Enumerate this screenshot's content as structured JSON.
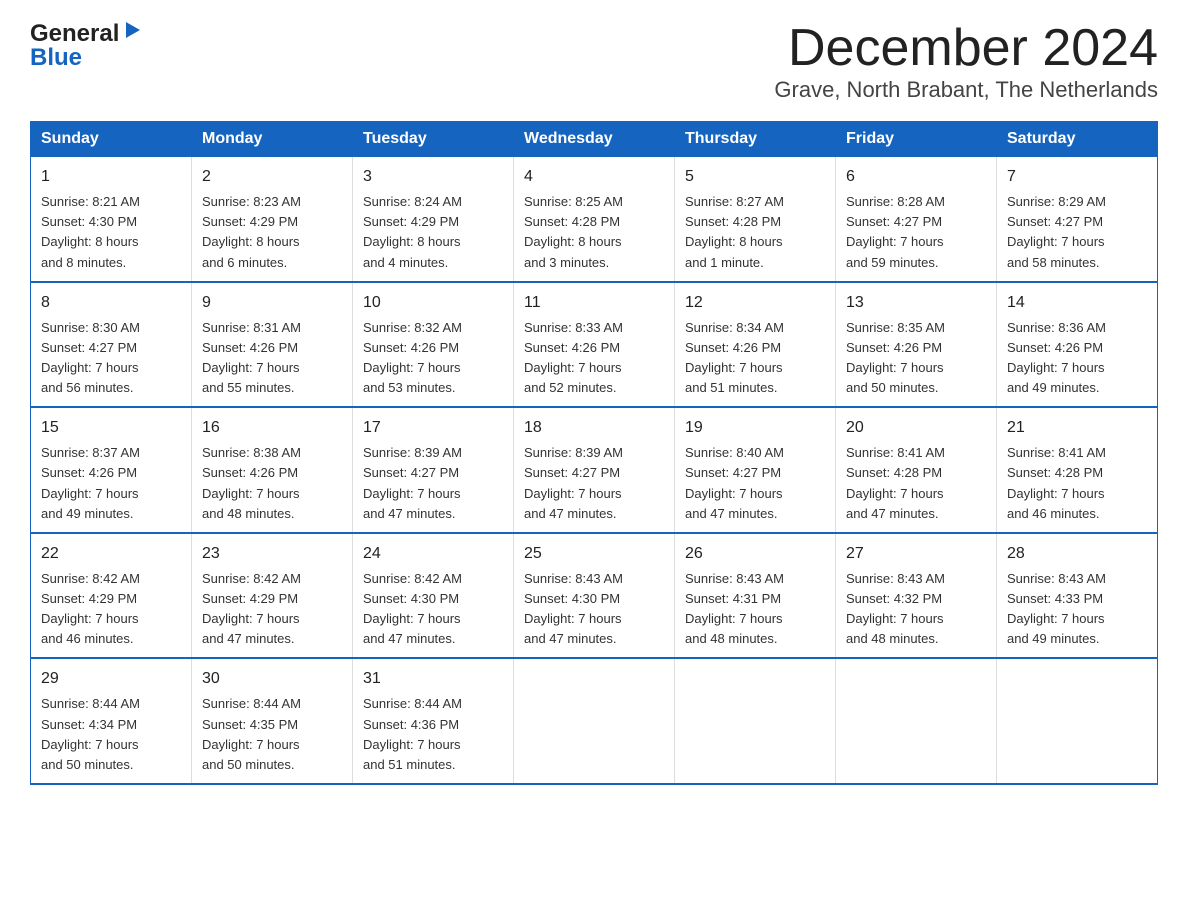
{
  "header": {
    "logo_general": "General",
    "logo_blue": "Blue",
    "month_title": "December 2024",
    "location": "Grave, North Brabant, The Netherlands"
  },
  "days_of_week": [
    "Sunday",
    "Monday",
    "Tuesday",
    "Wednesday",
    "Thursday",
    "Friday",
    "Saturday"
  ],
  "weeks": [
    [
      {
        "num": "1",
        "sunrise": "8:21 AM",
        "sunset": "4:30 PM",
        "daylight": "8 hours and 8 minutes."
      },
      {
        "num": "2",
        "sunrise": "8:23 AM",
        "sunset": "4:29 PM",
        "daylight": "8 hours and 6 minutes."
      },
      {
        "num": "3",
        "sunrise": "8:24 AM",
        "sunset": "4:29 PM",
        "daylight": "8 hours and 4 minutes."
      },
      {
        "num": "4",
        "sunrise": "8:25 AM",
        "sunset": "4:28 PM",
        "daylight": "8 hours and 3 minutes."
      },
      {
        "num": "5",
        "sunrise": "8:27 AM",
        "sunset": "4:28 PM",
        "daylight": "8 hours and 1 minute."
      },
      {
        "num": "6",
        "sunrise": "8:28 AM",
        "sunset": "4:27 PM",
        "daylight": "7 hours and 59 minutes."
      },
      {
        "num": "7",
        "sunrise": "8:29 AM",
        "sunset": "4:27 PM",
        "daylight": "7 hours and 58 minutes."
      }
    ],
    [
      {
        "num": "8",
        "sunrise": "8:30 AM",
        "sunset": "4:27 PM",
        "daylight": "7 hours and 56 minutes."
      },
      {
        "num": "9",
        "sunrise": "8:31 AM",
        "sunset": "4:26 PM",
        "daylight": "7 hours and 55 minutes."
      },
      {
        "num": "10",
        "sunrise": "8:32 AM",
        "sunset": "4:26 PM",
        "daylight": "7 hours and 53 minutes."
      },
      {
        "num": "11",
        "sunrise": "8:33 AM",
        "sunset": "4:26 PM",
        "daylight": "7 hours and 52 minutes."
      },
      {
        "num": "12",
        "sunrise": "8:34 AM",
        "sunset": "4:26 PM",
        "daylight": "7 hours and 51 minutes."
      },
      {
        "num": "13",
        "sunrise": "8:35 AM",
        "sunset": "4:26 PM",
        "daylight": "7 hours and 50 minutes."
      },
      {
        "num": "14",
        "sunrise": "8:36 AM",
        "sunset": "4:26 PM",
        "daylight": "7 hours and 49 minutes."
      }
    ],
    [
      {
        "num": "15",
        "sunrise": "8:37 AM",
        "sunset": "4:26 PM",
        "daylight": "7 hours and 49 minutes."
      },
      {
        "num": "16",
        "sunrise": "8:38 AM",
        "sunset": "4:26 PM",
        "daylight": "7 hours and 48 minutes."
      },
      {
        "num": "17",
        "sunrise": "8:39 AM",
        "sunset": "4:27 PM",
        "daylight": "7 hours and 47 minutes."
      },
      {
        "num": "18",
        "sunrise": "8:39 AM",
        "sunset": "4:27 PM",
        "daylight": "7 hours and 47 minutes."
      },
      {
        "num": "19",
        "sunrise": "8:40 AM",
        "sunset": "4:27 PM",
        "daylight": "7 hours and 47 minutes."
      },
      {
        "num": "20",
        "sunrise": "8:41 AM",
        "sunset": "4:28 PM",
        "daylight": "7 hours and 47 minutes."
      },
      {
        "num": "21",
        "sunrise": "8:41 AM",
        "sunset": "4:28 PM",
        "daylight": "7 hours and 46 minutes."
      }
    ],
    [
      {
        "num": "22",
        "sunrise": "8:42 AM",
        "sunset": "4:29 PM",
        "daylight": "7 hours and 46 minutes."
      },
      {
        "num": "23",
        "sunrise": "8:42 AM",
        "sunset": "4:29 PM",
        "daylight": "7 hours and 47 minutes."
      },
      {
        "num": "24",
        "sunrise": "8:42 AM",
        "sunset": "4:30 PM",
        "daylight": "7 hours and 47 minutes."
      },
      {
        "num": "25",
        "sunrise": "8:43 AM",
        "sunset": "4:30 PM",
        "daylight": "7 hours and 47 minutes."
      },
      {
        "num": "26",
        "sunrise": "8:43 AM",
        "sunset": "4:31 PM",
        "daylight": "7 hours and 48 minutes."
      },
      {
        "num": "27",
        "sunrise": "8:43 AM",
        "sunset": "4:32 PM",
        "daylight": "7 hours and 48 minutes."
      },
      {
        "num": "28",
        "sunrise": "8:43 AM",
        "sunset": "4:33 PM",
        "daylight": "7 hours and 49 minutes."
      }
    ],
    [
      {
        "num": "29",
        "sunrise": "8:44 AM",
        "sunset": "4:34 PM",
        "daylight": "7 hours and 50 minutes."
      },
      {
        "num": "30",
        "sunrise": "8:44 AM",
        "sunset": "4:35 PM",
        "daylight": "7 hours and 50 minutes."
      },
      {
        "num": "31",
        "sunrise": "8:44 AM",
        "sunset": "4:36 PM",
        "daylight": "7 hours and 51 minutes."
      },
      null,
      null,
      null,
      null
    ]
  ],
  "labels": {
    "sunrise": "Sunrise: ",
    "sunset": "Sunset: ",
    "daylight": "Daylight: "
  }
}
